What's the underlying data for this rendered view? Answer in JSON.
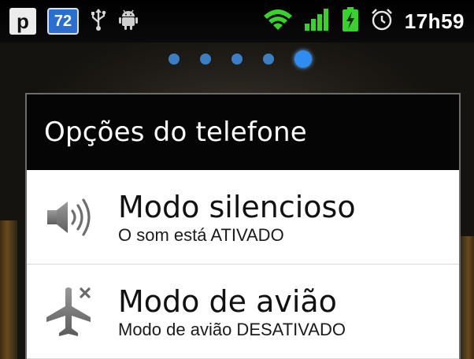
{
  "status_bar": {
    "p_icon_label": "p",
    "badge_count": "72",
    "time": "17h59",
    "icons": [
      "p-app-icon",
      "notification-count-icon",
      "usb-icon",
      "android-debug-icon",
      "wifi-icon",
      "cell-signal-icon",
      "battery-charging-icon",
      "alarm-icon"
    ],
    "colors": {
      "wifi": "#39d12b",
      "signal": "#39d12b",
      "battery": "#39d12b",
      "badge": "#2a6fd0"
    }
  },
  "home_screen": {
    "page_count": 5,
    "active_page": 5,
    "dot_color": "#3c7ec4"
  },
  "dialog": {
    "title": "Opções do telefone",
    "items": [
      {
        "icon": "volume-speaker-icon",
        "title": "Modo silencioso",
        "subtitle": "O som está ATIVADO"
      },
      {
        "icon": "airplane-mode-icon",
        "title": "Modo de avião",
        "subtitle": "Modo de avião DESATIVADO"
      }
    ]
  }
}
